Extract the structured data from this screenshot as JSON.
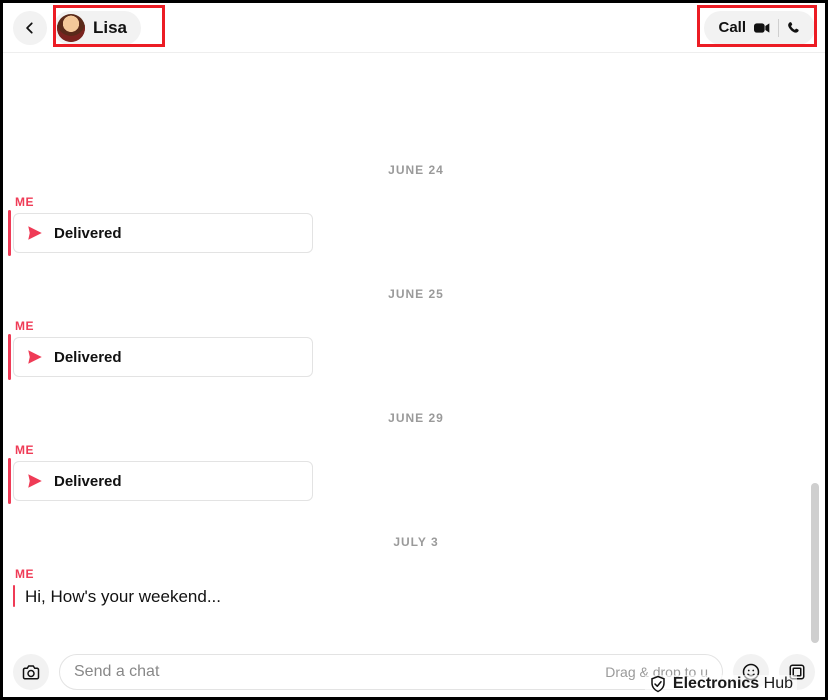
{
  "header": {
    "contact_name": "Lisa",
    "call_label": "Call"
  },
  "chat": {
    "sections": [
      {
        "date": "JUNE 24",
        "me_label": "ME",
        "status": "Delivered"
      },
      {
        "date": "JUNE 25",
        "me_label": "ME",
        "status": "Delivered"
      },
      {
        "date": "JUNE 29",
        "me_label": "ME",
        "status": "Delivered"
      },
      {
        "date": "JULY 3",
        "me_label": "ME",
        "text": "Hi, How's your weekend..."
      }
    ]
  },
  "composer": {
    "placeholder": "Send a chat",
    "drop_hint": "Drag & drop to u"
  },
  "watermark": {
    "brand1": "Electronics",
    "brand2": "Hub"
  }
}
